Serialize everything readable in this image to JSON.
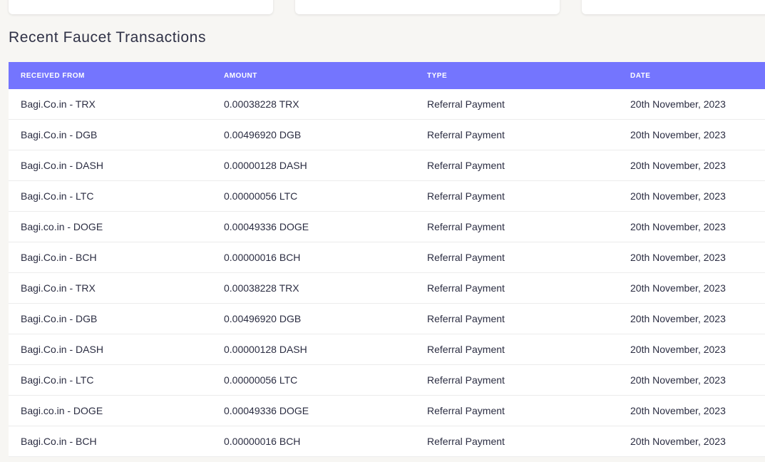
{
  "section": {
    "title": "Recent Faucet Transactions"
  },
  "table": {
    "headers": [
      "RECEIVED FROM",
      "AMOUNT",
      "TYPE",
      "DATE"
    ],
    "rows": [
      [
        "Bagi.Co.in - TRX",
        "0.00038228 TRX",
        "Referral Payment",
        "20th November, 2023"
      ],
      [
        "Bagi.Co.in - DGB",
        "0.00496920 DGB",
        "Referral Payment",
        "20th November, 2023"
      ],
      [
        "Bagi.Co.in - DASH",
        "0.00000128 DASH",
        "Referral Payment",
        "20th November, 2023"
      ],
      [
        "Bagi.Co.in - LTC",
        "0.00000056 LTC",
        "Referral Payment",
        "20th November, 2023"
      ],
      [
        "Bagi.co.in - DOGE",
        "0.00049336 DOGE",
        "Referral Payment",
        "20th November, 2023"
      ],
      [
        "Bagi.Co.in - BCH",
        "0.00000016 BCH",
        "Referral Payment",
        "20th November, 2023"
      ],
      [
        "Bagi.Co.in - TRX",
        "0.00038228 TRX",
        "Referral Payment",
        "20th November, 2023"
      ],
      [
        "Bagi.Co.in - DGB",
        "0.00496920 DGB",
        "Referral Payment",
        "20th November, 2023"
      ],
      [
        "Bagi.Co.in - DASH",
        "0.00000128 DASH",
        "Referral Payment",
        "20th November, 2023"
      ],
      [
        "Bagi.Co.in - LTC",
        "0.00000056 LTC",
        "Referral Payment",
        "20th November, 2023"
      ],
      [
        "Bagi.co.in - DOGE",
        "0.00049336 DOGE",
        "Referral Payment",
        "20th November, 2023"
      ],
      [
        "Bagi.Co.in - BCH",
        "0.00000016 BCH",
        "Referral Payment",
        "20th November, 2023"
      ]
    ]
  },
  "colors": {
    "header_bg": "#7475fe",
    "page_bg": "#f7f6f3",
    "text": "#2b2d42"
  }
}
